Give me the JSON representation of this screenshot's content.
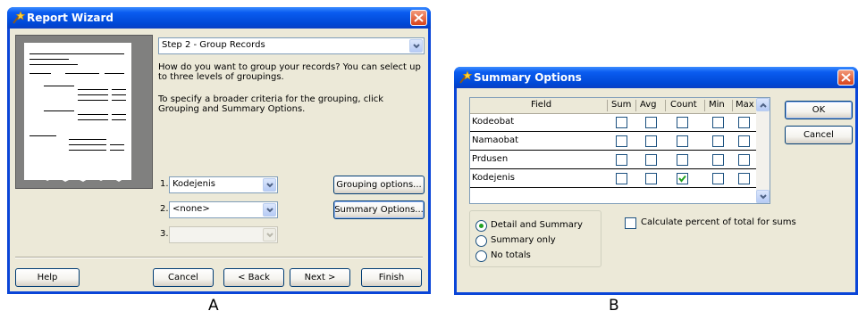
{
  "wizard": {
    "title": "Report Wizard",
    "step_value": "Step 2 - Group Records",
    "instruction_1": "How do you want to group your records? You can select up to three levels of groupings.",
    "instruction_2": "To specify a broader criteria for the grouping, click Grouping and Summary Options.",
    "levels": [
      {
        "number": "1.",
        "value": "Kodejenis"
      },
      {
        "number": "2.",
        "value": "<none>"
      },
      {
        "number": "3.",
        "value": ""
      }
    ],
    "grouping_options_label": "Grouping options...",
    "summary_options_label": "Summary Options...",
    "buttons": {
      "help": "Help",
      "cancel": "Cancel",
      "back": "< Back",
      "next": "Next >",
      "finish": "Finish"
    }
  },
  "summary": {
    "title": "Summary Options",
    "columns": [
      "Field",
      "Sum",
      "Avg",
      "Count",
      "Min",
      "Max"
    ],
    "rows": [
      {
        "field": "Kodeobat",
        "checks": [
          false,
          false,
          false,
          false,
          false
        ]
      },
      {
        "field": "Namaobat",
        "checks": [
          false,
          false,
          false,
          false,
          false
        ]
      },
      {
        "field": "Prdusen",
        "checks": [
          false,
          false,
          false,
          false,
          false
        ]
      },
      {
        "field": "Kodejenis",
        "checks": [
          false,
          false,
          true,
          false,
          false
        ]
      }
    ],
    "ok_label": "OK",
    "cancel_label": "Cancel",
    "radio_options": [
      {
        "label": "Detail and Summary",
        "selected": true
      },
      {
        "label": "Summary only",
        "selected": false
      },
      {
        "label": "No totals",
        "selected": false
      }
    ],
    "percent_label": "Calculate percent of total for sums",
    "percent_checked": false
  },
  "captions": {
    "a": "A",
    "b": "B"
  },
  "colors": {
    "title_bar": "#0a5cf0",
    "client": "#ece9d8",
    "close": "#d8431b",
    "check": "#21a121"
  }
}
